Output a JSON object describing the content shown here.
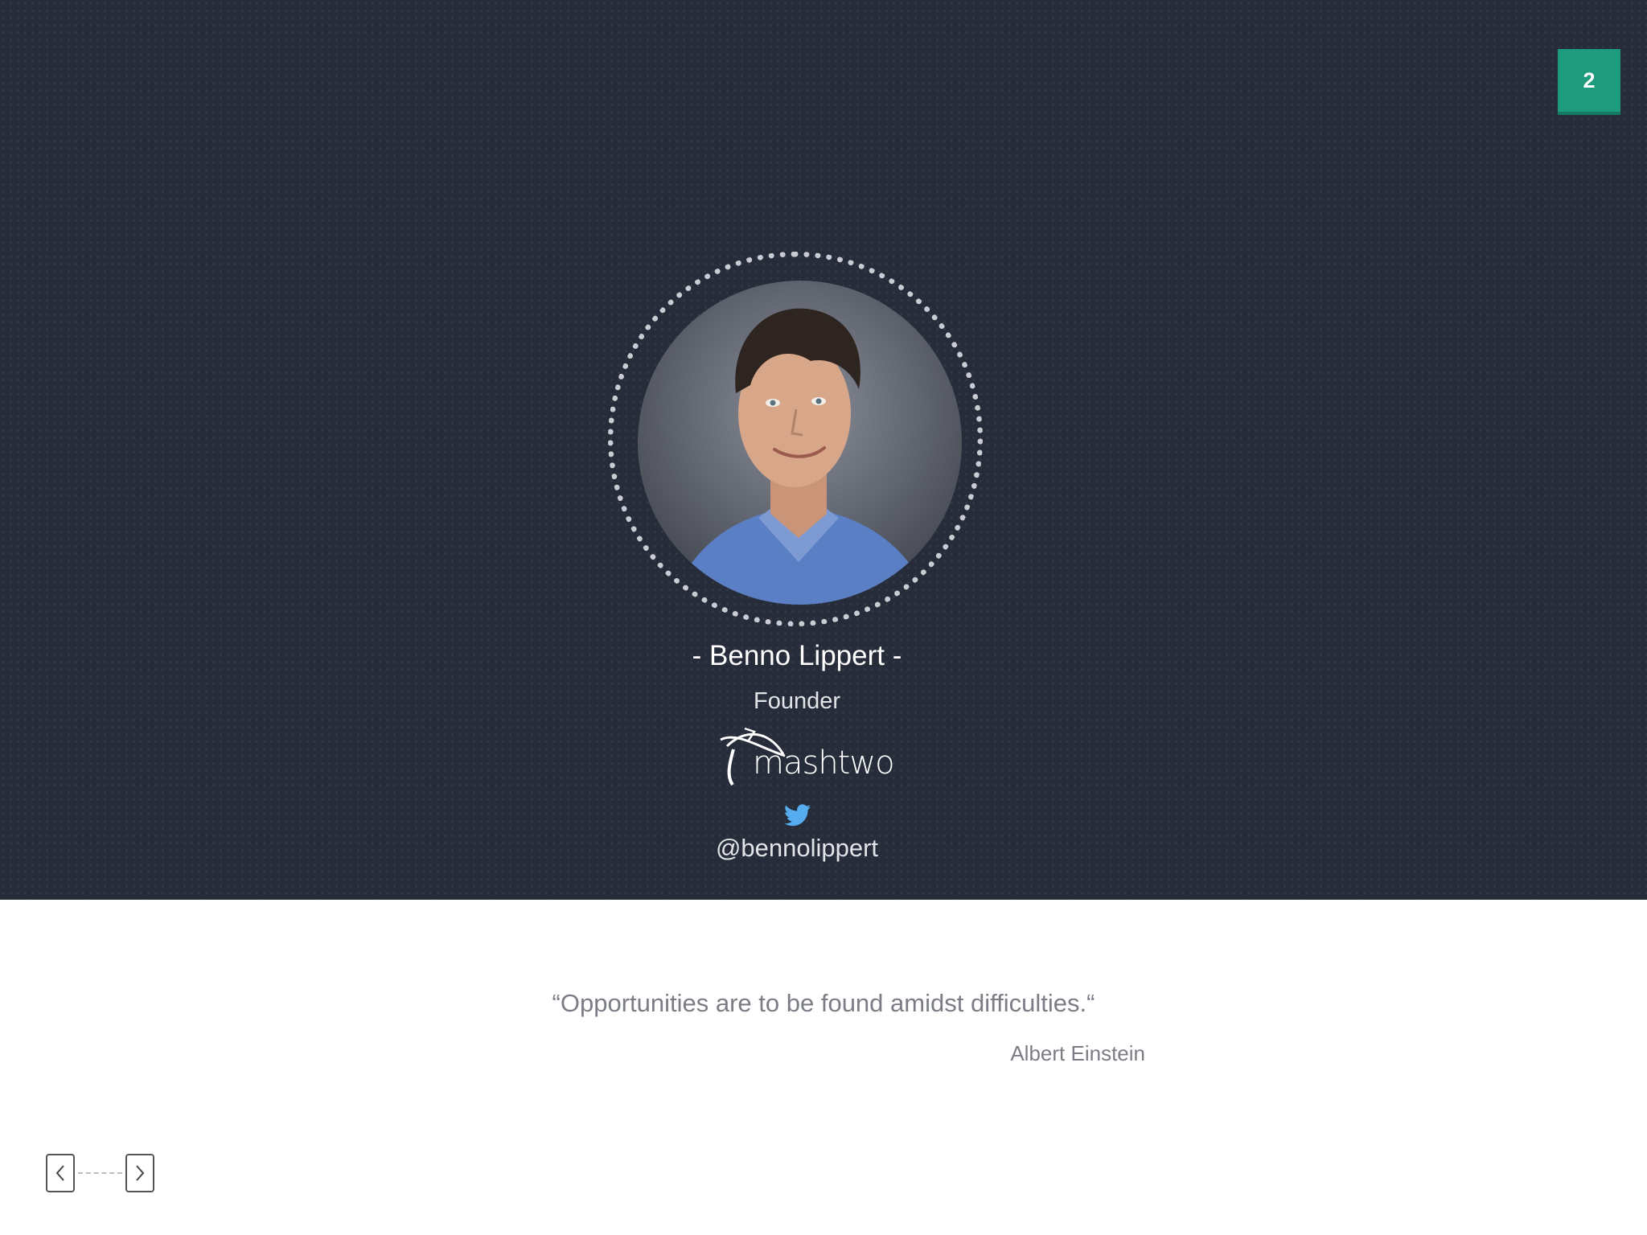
{
  "slide": {
    "page_number": "2"
  },
  "profile": {
    "name": "- Benno Lippert -",
    "role": "Founder",
    "company_logo_text": "mashtwo",
    "twitter_handle": "@bennolippert"
  },
  "quote": {
    "text": "“Opportunities are to be found amidst difficulties.“",
    "author": "Albert Einstein"
  },
  "icons": {
    "twitter": "twitter-bird-icon",
    "prev": "chevron-left-icon",
    "next": "chevron-right-icon"
  },
  "colors": {
    "background_dark": "#262c39",
    "accent_green": "#1e9a7c",
    "twitter_blue": "#55acee",
    "quote_gray": "#7b7d85"
  }
}
